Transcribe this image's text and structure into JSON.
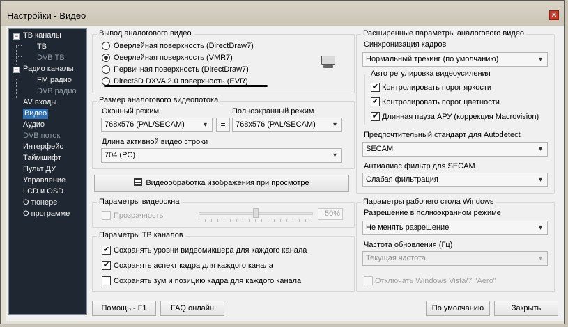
{
  "window": {
    "title": "Настройки - Видео"
  },
  "sidebar": {
    "items": [
      {
        "label": "ТВ каналы",
        "expander": "−"
      },
      {
        "label": "ТВ"
      },
      {
        "label": "DVB ТВ"
      },
      {
        "label": "Радио каналы",
        "expander": "−"
      },
      {
        "label": "FM радио"
      },
      {
        "label": "DVB радио"
      },
      {
        "label": "AV входы"
      },
      {
        "label": "Видео"
      },
      {
        "label": "Аудио"
      },
      {
        "label": "DVB поток"
      },
      {
        "label": "Интерфейс"
      },
      {
        "label": "Таймшифт"
      },
      {
        "label": "Пульт ДУ"
      },
      {
        "label": "Управление"
      },
      {
        "label": "LCD и OSD"
      },
      {
        "label": "О тюнере"
      },
      {
        "label": "О программе"
      }
    ]
  },
  "analog_output": {
    "title": "Вывод аналогового видео",
    "options": [
      "Оверлейная поверхность (DirectDraw7)",
      "Оверлейная поверхность (VMR7)",
      "Первичная поверхность (DirectDraw7)",
      "Direct3D DXVA 2.0 поверхность (EVR)"
    ],
    "selected_index": 1,
    "icon": "monitor-icon"
  },
  "stream_size": {
    "title": "Размер аналогового видеопотока",
    "windowed_label": "Оконный режим",
    "windowed_value": "768x576 (PAL/SECAM)",
    "link_symbol": "=",
    "fullscreen_label": "Полноэкранный режим",
    "fullscreen_value": "768x576 (PAL/SECAM)",
    "active_line_label": "Длина активной видео строки",
    "active_line_value": "704 (PC)"
  },
  "preview_button": {
    "label": "Видеообработка изображения при просмотре",
    "icon": "film-icon"
  },
  "video_window": {
    "title": "Параметры видеоокна",
    "transparency_label": "Прозрачность",
    "transparency_value": "50%",
    "transparency_level": 0.5
  },
  "tv_params": {
    "title": "Параметры ТВ каналов",
    "options": [
      {
        "label": "Сохранять уровни видеомикшера для каждого канала",
        "checked": true
      },
      {
        "label": "Сохранять аспект кадра для каждого канала",
        "checked": true
      },
      {
        "label": "Сохранять зум и позицию кадра для каждого канала",
        "checked": false
      }
    ]
  },
  "advanced": {
    "title": "Расширенные параметры аналогового видео",
    "sync_label": "Синхронизация кадров",
    "sync_value": "Нормальный трекинг (по умолчанию)",
    "agc_title": "Авто регулировка видеоусиления",
    "agc_options": [
      {
        "label": "Контролировать порог яркости",
        "checked": true
      },
      {
        "label": "Контролировать порог цветности",
        "checked": true
      },
      {
        "label": "Длинная пауза АРУ (коррекция Macrovision)",
        "checked": true
      }
    ],
    "standard_label": "Предпочтительный стандарт для Autodetect",
    "standard_value": "SECAM",
    "antialias_label": "Антиалиас фильтр для SECAM",
    "antialias_value": "Слабая фильтрация"
  },
  "desktop": {
    "title": "Параметры рабочего стола Windows",
    "resolution_label": "Разрешение в полноэкранном режиме",
    "resolution_value": "Не менять разрешение",
    "refresh_label": "Частота обновления (Гц)",
    "refresh_value": "Текущая частота",
    "aero_label": "Отключать Windows Vista/7 \"Aero\""
  },
  "footer": {
    "help": "Помощь - F1",
    "faq": "FAQ онлайн",
    "defaults": "По умолчанию",
    "close": "Закрыть"
  },
  "colors": {
    "sidebar_bg": "#1f2832",
    "selection": "#2d6fb0",
    "accent_close": "#c63a2a"
  }
}
